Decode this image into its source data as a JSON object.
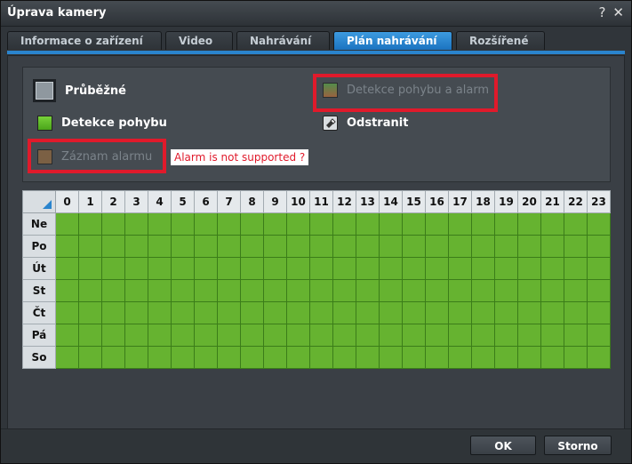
{
  "window": {
    "title": "Úprava kamery",
    "help": "?",
    "close": "✕"
  },
  "tabs": [
    {
      "label": "Informace o zařízení",
      "active": false
    },
    {
      "label": "Video",
      "active": false
    },
    {
      "label": "Nahrávání",
      "active": false
    },
    {
      "label": "Plán nahrávání",
      "active": true
    },
    {
      "label": "Rozšířené",
      "active": false
    }
  ],
  "legend": {
    "continuous": "Průběžné",
    "motion": "Detekce pohybu",
    "alarm": "Záznam alarmu",
    "motion_alarm": "Detekce pohybu a alarm",
    "erase": "Odstranit"
  },
  "annotation": "Alarm is not supported ?",
  "schedule": {
    "hours": [
      "0",
      "1",
      "2",
      "3",
      "4",
      "5",
      "6",
      "7",
      "8",
      "9",
      "10",
      "11",
      "12",
      "13",
      "14",
      "15",
      "16",
      "17",
      "18",
      "19",
      "20",
      "21",
      "22",
      "23"
    ],
    "days": [
      "Ne",
      "Po",
      "Út",
      "St",
      "Čt",
      "Pá",
      "So"
    ]
  },
  "buttons": {
    "ok": "OK",
    "cancel": "Storno"
  },
  "colors": {
    "accent": "#2a84cd",
    "motion_cell": "#66b330",
    "highlight": "#e01a2b"
  }
}
